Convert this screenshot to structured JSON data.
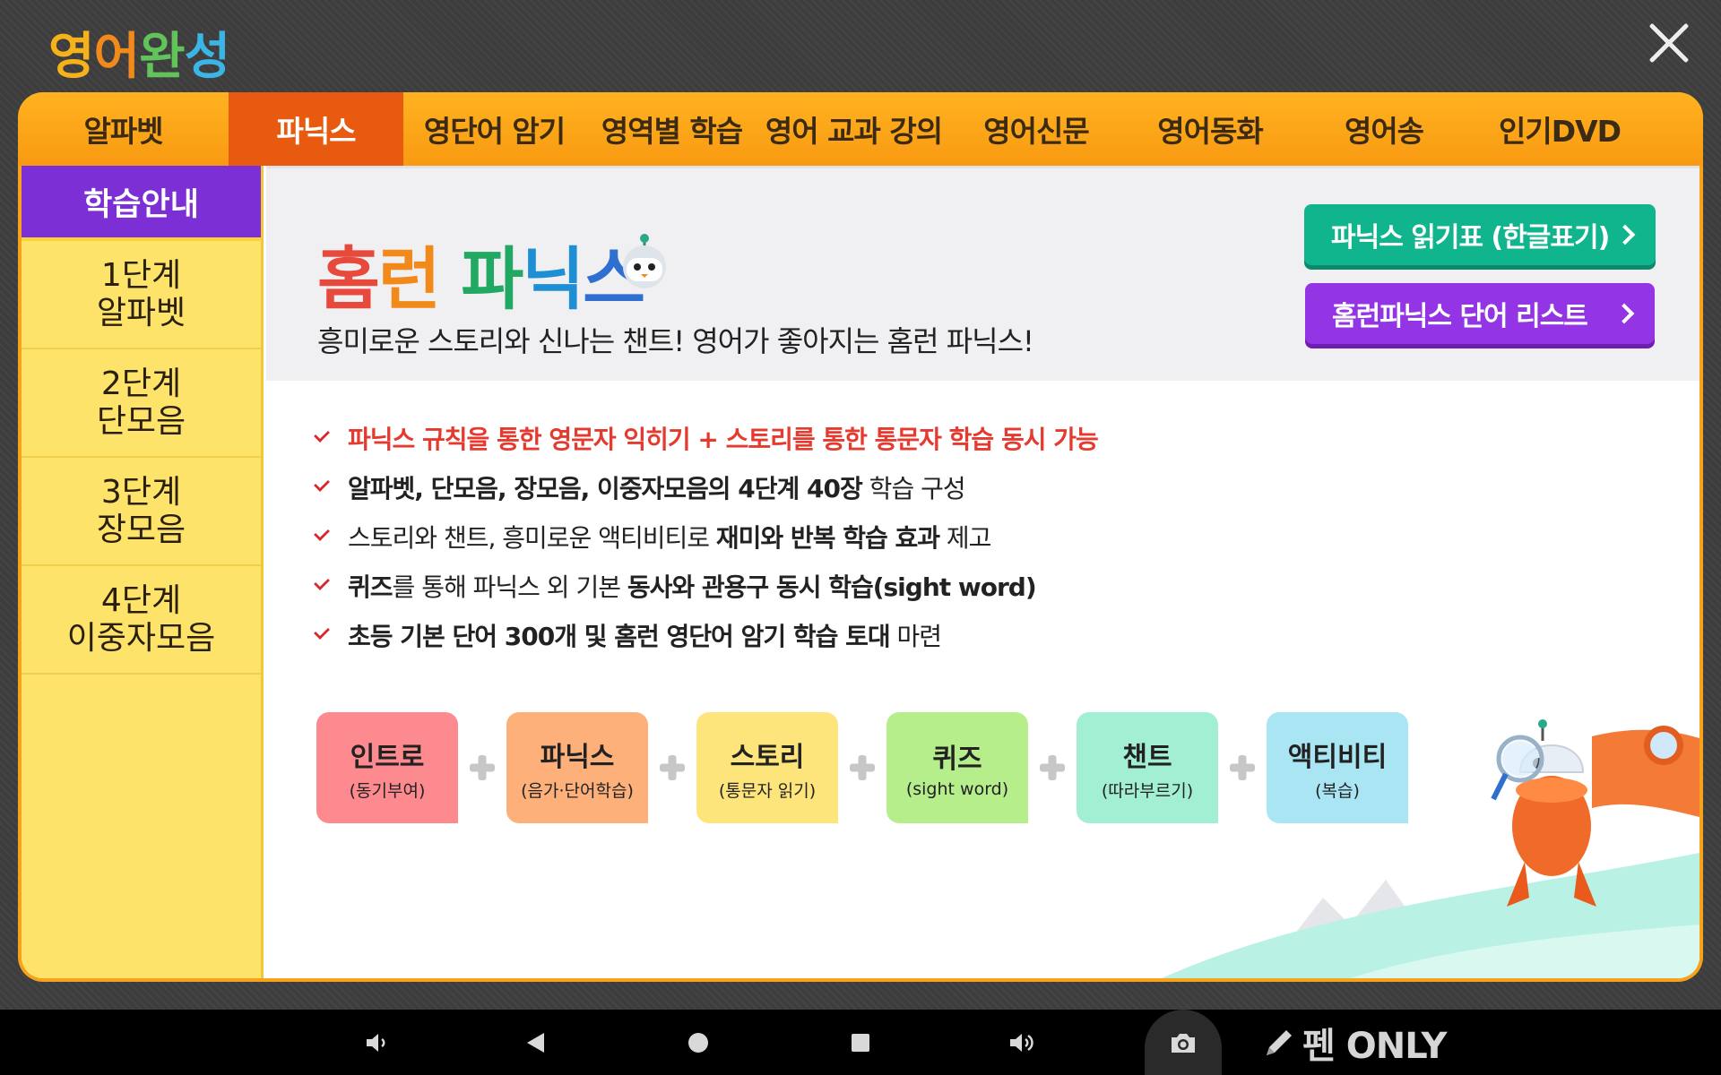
{
  "app": {
    "logo_chars": [
      "영",
      "어",
      "완",
      "성"
    ],
    "logo_colors": [
      "#f6b21b",
      "#f28a1b",
      "#63c35b",
      "#3bb5e6"
    ]
  },
  "nav": {
    "items": [
      {
        "label": "알파벳",
        "active": false
      },
      {
        "label": "파닉스",
        "active": true
      },
      {
        "label": "영단어 암기",
        "active": false
      },
      {
        "label": "영역별 학습",
        "active": false
      },
      {
        "label": "영어 교과 강의",
        "active": false
      },
      {
        "label": "영어신문",
        "active": false
      },
      {
        "label": "영어동화",
        "active": false
      },
      {
        "label": "영어송",
        "active": false
      },
      {
        "label": "인기DVD",
        "active": false
      }
    ]
  },
  "sidebar": {
    "header": "학습안내",
    "items": [
      {
        "line1": "1단계",
        "line2": "알파벳"
      },
      {
        "line1": "2단계",
        "line2": "단모음"
      },
      {
        "line1": "3단계",
        "line2": "장모음"
      },
      {
        "line1": "4단계",
        "line2": "이중자모음"
      }
    ]
  },
  "banner": {
    "title_parts": [
      "홈",
      "런",
      "파",
      "닉",
      "스"
    ],
    "subtitle": "흥미로운 스토리와 신나는 챈트! 영어가 좋아지는 홈런 파닉스!",
    "button_chart": "파닉스 읽기표 (한글표기)",
    "button_words": "홈런파닉스 단어 리스트"
  },
  "features": {
    "f1": "파닉스 규칙을 통한 영문자 익히기 + 스토리를 통한 통문자 학습 동시 가능",
    "f2_bold": "알파벳, 단모음, 장모음, 이중자모음의 4단계 40장",
    "f2_rest": " 학습 구성",
    "f3_plain": "스토리와 챈트, 흥미로운 액티비티로 ",
    "f3_bold": "재미와 반복 학습 효과",
    "f3_rest": " 제고",
    "f4_bold1": "퀴즈",
    "f4_plain": "를 통해 파닉스 외 기본 ",
    "f4_bold2": "동사와 관용구 동시 학습(sight word)",
    "f5_bold": "초등 기본 단어 300개 및 홈런 영단어 암기 학습 토대",
    "f5_rest": " 마련"
  },
  "steps": [
    {
      "title": "인트로",
      "sub": "(동기부여)",
      "color": "#fd8a8e"
    },
    {
      "title": "파닉스",
      "sub": "(음가·단어학습)",
      "color": "#fdb07a"
    },
    {
      "title": "스토리",
      "sub": "(통문자 읽기)",
      "color": "#fde57c"
    },
    {
      "title": "퀴즈",
      "sub": "(sight word)",
      "color": "#b6ee8c"
    },
    {
      "title": "챈트",
      "sub": "(따라부르기)",
      "color": "#a2efd4"
    },
    {
      "title": "액티비티",
      "sub": "(복습)",
      "color": "#a9e5f3"
    }
  ],
  "system_bar": {
    "pen_label": "펜 ONLY"
  }
}
